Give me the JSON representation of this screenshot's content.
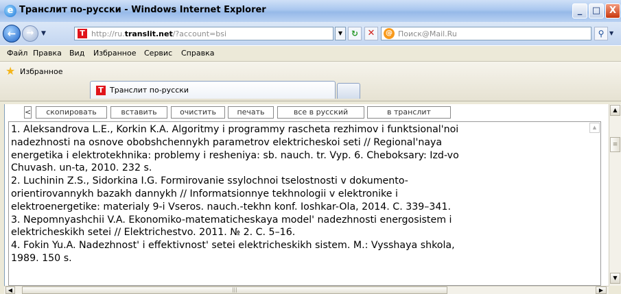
{
  "window": {
    "title": "Транслит по-русски - Windows Internet Explorer",
    "icon": "ie-icon",
    "buttons": {
      "minimize": "_",
      "maximize": "□",
      "close": "X"
    }
  },
  "address": {
    "url_prefix": "http://ru.",
    "url_domain": "translit.net",
    "url_suffix": "/?account=bsi",
    "search_placeholder": "Поиск@Mail.Ru"
  },
  "menu": {
    "items": [
      "Файл",
      "Правка",
      "Вид",
      "Избранное",
      "Сервис",
      "Справка"
    ]
  },
  "favorites": {
    "label": "Избранное",
    "tab_title": "Транслит по-русски"
  },
  "toolbar": {
    "back_arrow": "<",
    "buttons": [
      "скопировать",
      "вставить",
      "очистить",
      "печать",
      "все в русский",
      "в транслит"
    ]
  },
  "content": {
    "lines": [
      "1. Aleksandrova L.E., Korkin K.A. Algoritmy i programmy rascheta rezhimov i funktsional'noi",
      "nadezhnosti na osnove obobshchennykh parametrov elektricheskoi seti // Regional'naya",
      "energetika i elektrotekhnika: problemy i resheniya: sb. nauch. tr. Vyp. 6. Cheboksary: Izd-vo",
      "Chuvash. un-ta, 2010. 232 s.",
      "2. Luchinin Z.S., Sidorkina I.G. Formirovanie ssylochnoi tselostnosti v dokumento-",
      "orientirovannykh bazakh dannykh // Informatsionnye tekhnologii v elektronike i",
      "elektroenergetike: materialy 9-i Vseros. nauch.-tekhn konf. Ioshkar-Ola, 2014. C. 339–341.",
      "3. Nepomnyashchii V.A. Ekonomiko-matematicheskaya model' nadezhnosti energosistem i",
      "elektricheskikh setei // Elektrichestvo. 2011. № 2. C. 5–16.",
      "4. Fokin Yu.A. Nadezhnost' i effektivnost' setei elektricheskikh sistem. M.: Vysshaya shkola,",
      "1989. 150 s."
    ]
  },
  "colors": {
    "accent": "#1c63c8",
    "site_icon": "#e0141b"
  }
}
